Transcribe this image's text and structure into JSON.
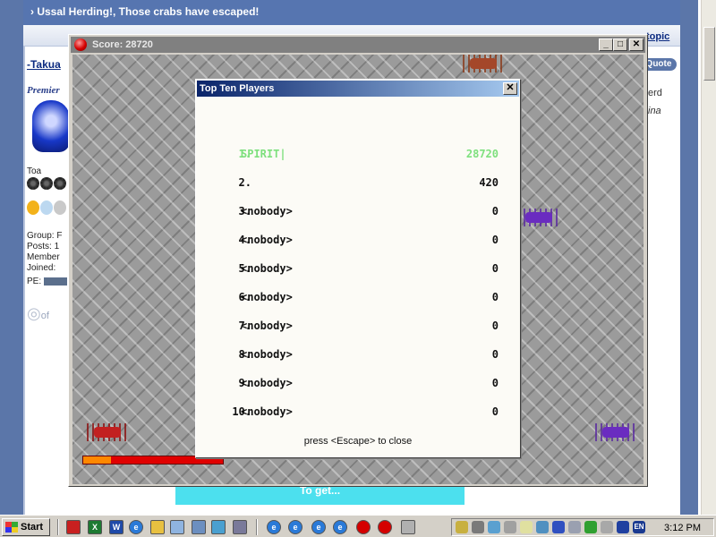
{
  "forum": {
    "banner": "› Ussal Herding!, Those crabs have escaped!",
    "topic_link": "topic",
    "quote_button": "Quote",
    "author": "-Takua",
    "member_title": "Premier",
    "rank": "Toa",
    "info_lines": [
      "Group: F",
      "Posts: 1",
      "Member",
      "Joined:"
    ],
    "pe_label": "PE:",
    "of_logo": "of",
    "side_text_1": "erd",
    "side_text_2": "ina",
    "bottom_text": "To get..."
  },
  "game": {
    "title": "Score: 28720",
    "buttons": {
      "minimize": "_",
      "maximize": "□",
      "close": "✕"
    },
    "health_fraction": 0.2,
    "colors": {
      "health_bar": "#e00000",
      "health_fill": "#ff8800",
      "red_crab": "#c22020",
      "purple_crab": "#6a2cc0"
    }
  },
  "highscores": {
    "title": "Top Ten Players",
    "close": "✕",
    "rows": [
      {
        "rank": "1.",
        "name": "SPIRIT|",
        "score": "28720",
        "highlight": true
      },
      {
        "rank": "2.",
        "name": "",
        "score": "420"
      },
      {
        "rank": "3.",
        "name": "<nobody>",
        "score": "0"
      },
      {
        "rank": "4.",
        "name": "<nobody>",
        "score": "0"
      },
      {
        "rank": "5.",
        "name": "<nobody>",
        "score": "0"
      },
      {
        "rank": "6.",
        "name": "<nobody>",
        "score": "0"
      },
      {
        "rank": "7.",
        "name": "<nobody>",
        "score": "0"
      },
      {
        "rank": "8.",
        "name": "<nobody>",
        "score": "0"
      },
      {
        "rank": "9.",
        "name": "<nobody>",
        "score": "0"
      },
      {
        "rank": "10.",
        "name": "<nobody>",
        "score": "0"
      }
    ],
    "footer": "press <Escape> to close",
    "highlight_color": "#7ee07e"
  },
  "taskbar": {
    "start": "Start",
    "clock": "3:12 PM",
    "lang": "EN",
    "quicklaunch_icons": [
      "media-icon",
      "excel-icon",
      "word-icon",
      "ie-icon",
      "folder-icon",
      "notepad-icon",
      "explorer-icon"
    ],
    "task_icons": [
      "ie-window-icon",
      "ie-window-icon",
      "ie-window-icon",
      "ie-window-icon",
      "game-icon",
      "game-icon",
      "calculator-icon"
    ]
  }
}
